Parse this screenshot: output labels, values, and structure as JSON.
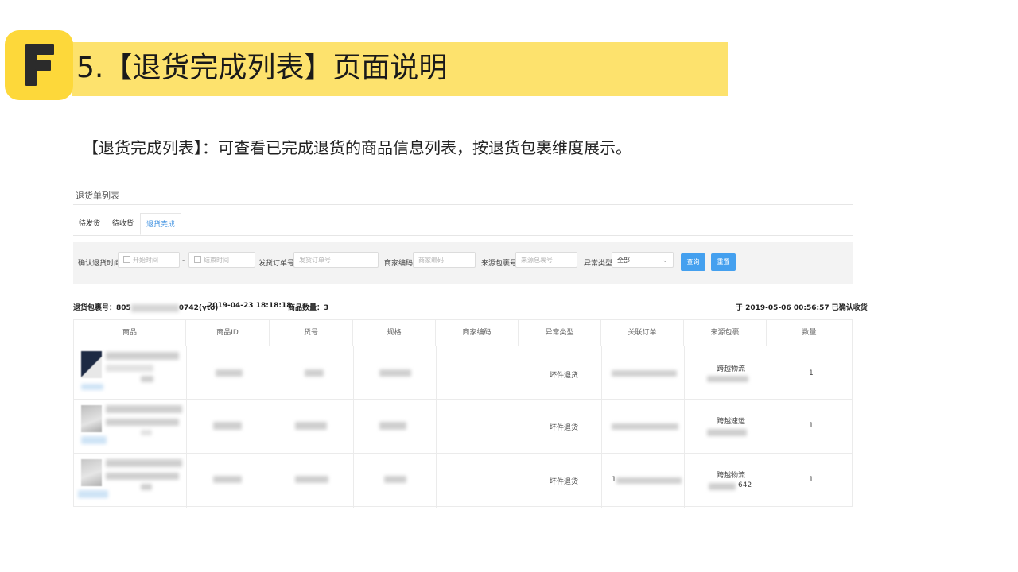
{
  "slide": {
    "logo_letter": "F",
    "title": "5.【退货完成列表】页面说明",
    "description": "【退货完成列表】：可查看已完成退货的商品信息列表，按退货包裹维度展示。"
  },
  "page": {
    "title": "退货单列表",
    "tabs": [
      {
        "label": "待发货"
      },
      {
        "label": "待收货"
      },
      {
        "label": "退货完成"
      }
    ]
  },
  "filters": {
    "confirm_time_label": "确认退货时间",
    "start_placeholder": "开始时间",
    "range_sep": "-",
    "end_placeholder": "结束时间",
    "ship_order_label": "发货订单号",
    "ship_order_placeholder": "发货订单号",
    "merchant_code_label": "商家编码",
    "merchant_code_placeholder": "商家编码",
    "source_pkg_label": "来源包裹号",
    "source_pkg_placeholder": "来源包裹号",
    "exception_label": "异常类型",
    "exception_value": "全部",
    "query_button": "查询",
    "reset_button": "重置"
  },
  "package": {
    "pkg_no_prefix": "退货包裹号：805",
    "pkg_no_suffix": "0742(yto)",
    "date": "2019-04-23 18:18:18",
    "qty_label": "商品数量：3",
    "confirmed": "于 2019-05-06 00:56:57 已确认收货"
  },
  "table": {
    "headers": [
      "商品",
      "商品ID",
      "货号",
      "规格",
      "商家编码",
      "异常类型",
      "关联订单",
      "来源包裹",
      "数量"
    ],
    "rows": [
      {
        "exception": "坏件退货",
        "source": "跨越物流",
        "source_suffix": "",
        "order_prefix": "",
        "qty": "1"
      },
      {
        "exception": "坏件退货",
        "source": "跨越速运",
        "source_suffix": "",
        "order_prefix": "",
        "qty": "1"
      },
      {
        "exception": "坏件退货",
        "source": "跨越物流",
        "source_suffix": "642",
        "order_prefix": "1",
        "qty": "1"
      }
    ]
  },
  "colors": {
    "band": "#fde26d",
    "logo": "#fdd83a",
    "accent": "#44a0ef",
    "active_tab": "#3b8fe0"
  }
}
